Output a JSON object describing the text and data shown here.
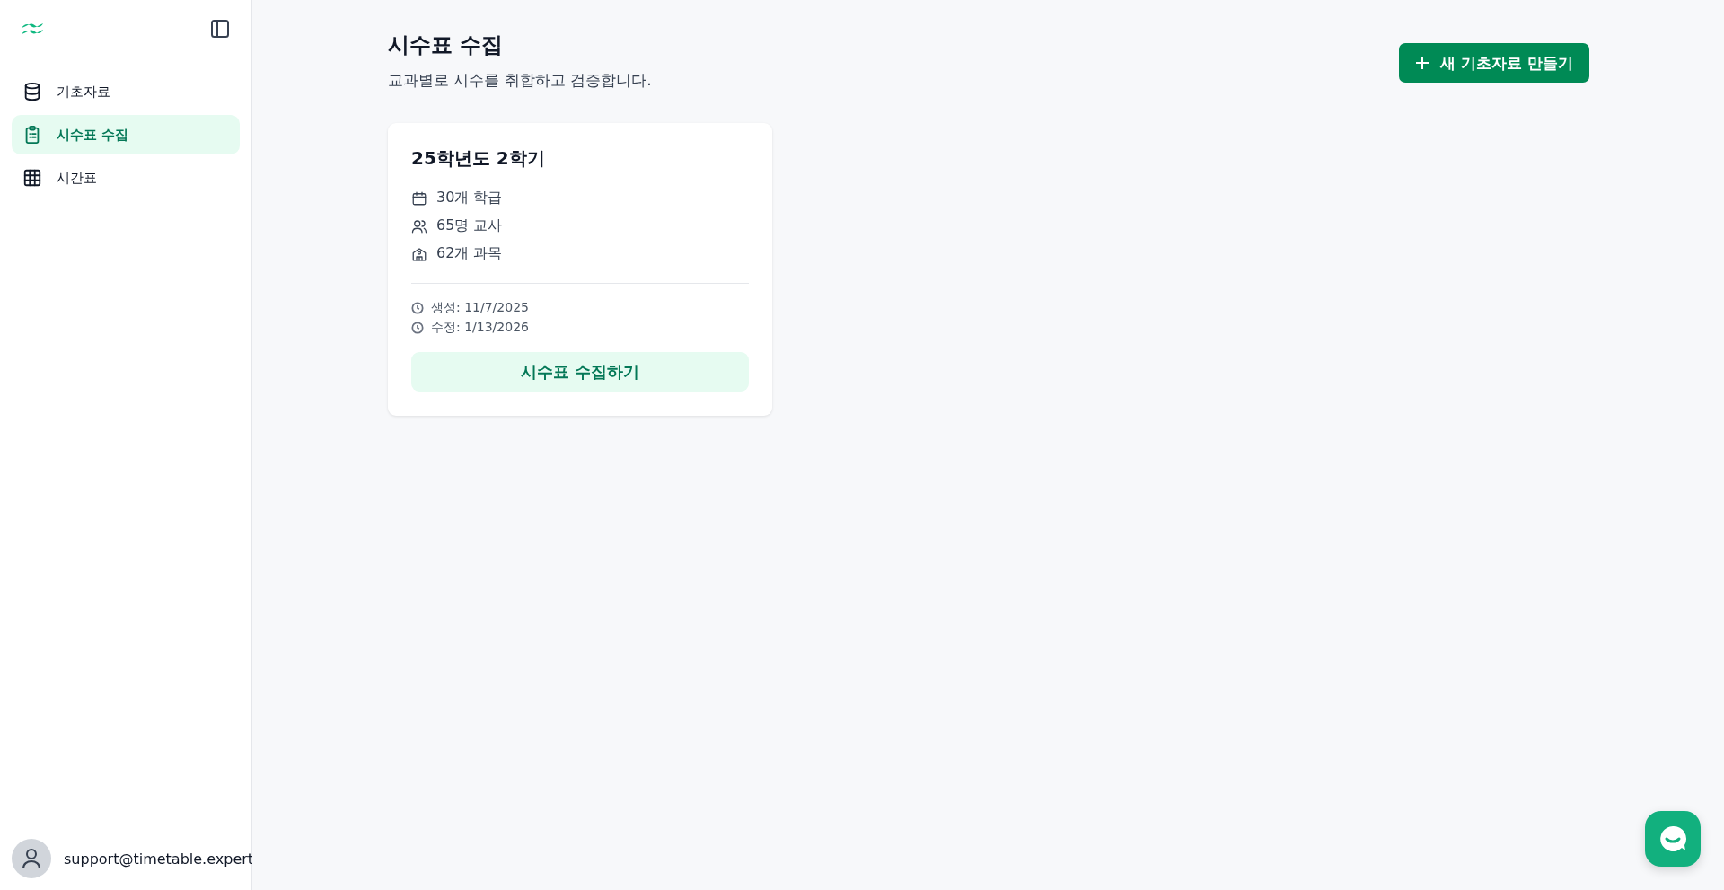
{
  "sidebar": {
    "items": [
      {
        "label": "기초자료",
        "kind": "database",
        "selected": false
      },
      {
        "label": "시수표 수집",
        "kind": "clipboard",
        "selected": true
      },
      {
        "label": "시간표",
        "kind": "grid",
        "selected": false
      }
    ],
    "user": {
      "email": "support@timetable.expert"
    }
  },
  "header": {
    "title": "시수표 수집",
    "subtitle": "교과별로 시수를 취합하고 검증합니다.",
    "new_button": "새 기초자료 만들기"
  },
  "cards": [
    {
      "title": "25학년도 2학기",
      "stats": [
        {
          "kind": "calendar",
          "text": "30개 학급"
        },
        {
          "kind": "users",
          "text": "65명 교사"
        },
        {
          "kind": "building",
          "text": "62개 과목"
        }
      ],
      "dates": [
        "생성: 11/7/2025",
        "수정: 1/13/2026"
      ],
      "action": "시수표 수집하기"
    }
  ]
}
